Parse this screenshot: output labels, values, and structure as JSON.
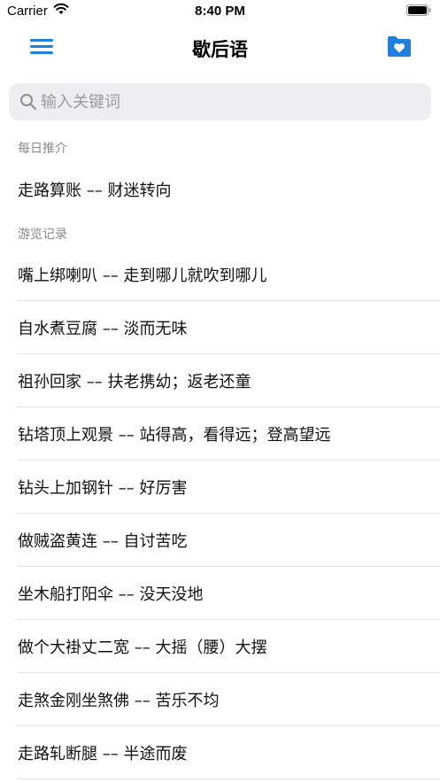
{
  "status_bar": {
    "carrier": "Carrier",
    "time": "8:40 PM"
  },
  "nav": {
    "title": "歇后语"
  },
  "search": {
    "placeholder": "输入关键词",
    "value": ""
  },
  "daily": {
    "header": "每日推介",
    "items": [
      {
        "text": "走路算账 –– 财迷转向"
      }
    ]
  },
  "history": {
    "header": "游览记录",
    "items": [
      {
        "text": "嘴上绑喇叭 –– 走到哪儿就吹到哪儿"
      },
      {
        "text": "自水煮豆腐 –– 淡而无味"
      },
      {
        "text": "祖孙回家 –– 扶老携幼；返老还童"
      },
      {
        "text": "钻塔顶上观景 –– 站得高，看得远；登高望远"
      },
      {
        "text": "钻头上加钢针 –– 好厉害"
      },
      {
        "text": "做贼盗黄连 –– 自讨苦吃"
      },
      {
        "text": "坐木船打阳伞 –– 没天没地"
      },
      {
        "text": "做个大褂丈二宽 –– 大摇（腰）大摆"
      },
      {
        "text": "走煞金刚坐煞佛 –– 苦乐不均"
      },
      {
        "text": "走路轧断腿 –– 半途而废"
      }
    ]
  },
  "colors": {
    "accent": "#1e7fe0",
    "divider": "#e2e2e5",
    "search_bg": "#eeeef0"
  }
}
